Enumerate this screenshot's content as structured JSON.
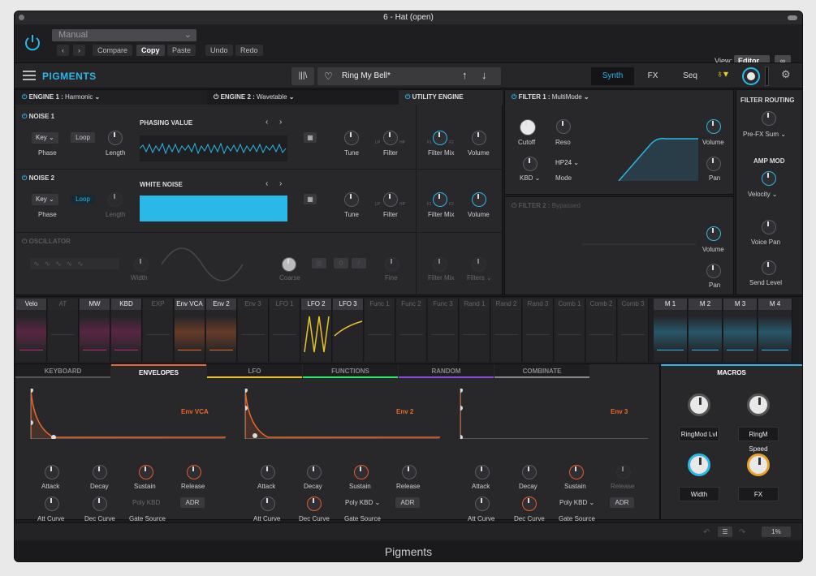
{
  "window": {
    "title": "6 - Hat (open)"
  },
  "plugin_toolbar": {
    "preset_select": "Manual",
    "compare": "Compare",
    "copy": "Copy",
    "paste": "Paste",
    "undo": "Undo",
    "redo": "Redo",
    "view_label": "View:",
    "view_value": "Editor"
  },
  "app": {
    "logo": "PIGMENTS",
    "preset_name": "Ring My Bell*",
    "tabs": {
      "synth": "Synth",
      "fx": "FX",
      "seq": "Seq"
    }
  },
  "engine1": {
    "title": "ENGINE 1 :",
    "type": "Harmonic",
    "noise1": {
      "title": "NOISE 1",
      "mode": "Key",
      "loop": "Loop",
      "phase": "Phase",
      "length": "Length",
      "sample_title": "PHASING VALUE",
      "tune": "Tune",
      "filter": "Filter",
      "lp": "LP",
      "hp": "HP"
    },
    "noise2": {
      "title": "NOISE 2",
      "mode": "Key",
      "loop": "Loop",
      "phase": "Phase",
      "length": "Length",
      "sample_title": "WHITE NOISE",
      "tune": "Tune",
      "filter": "Filter",
      "lp": "LP",
      "hp": "HP"
    },
    "oscillator": {
      "title": "OSCILLATOR",
      "width": "Width",
      "coarse": "Coarse",
      "fine": "Fine"
    }
  },
  "engine2": {
    "title": "ENGINE 2 :",
    "type": "Wavetable"
  },
  "utility": {
    "title": "UTILITY ENGINE",
    "filter_mix": "Filter Mix",
    "volume": "Volume",
    "f1": "F1",
    "f2": "F2",
    "filters": "Filters"
  },
  "filter1": {
    "title": "FILTER 1 :",
    "type": "MultiMode",
    "cutoff": "Cutoff",
    "reso": "Reso",
    "kbd": "KBD",
    "mode_value": "HP24",
    "mode": "Mode",
    "volume": "Volume",
    "pan": "Pan"
  },
  "filter2": {
    "title": "FILTER 2 :",
    "status": "Bypassed",
    "volume": "Volume",
    "pan": "Pan"
  },
  "routing": {
    "title": "FILTER ROUTING",
    "value": "Pre-FX Sum",
    "amp_mod": "AMP MOD",
    "amp_value": "Velocity",
    "voice_pan": "Voice Pan",
    "send_level": "Send Level"
  },
  "mod_sources": [
    "Velo",
    "AT",
    "MW",
    "KBD",
    "EXP",
    "Env VCA",
    "Env 2",
    "Env 3",
    "LFO 1",
    "LFO 2",
    "LFO 3",
    "Func 1",
    "Func 2",
    "Func 3",
    "Rand 1",
    "Rand 2",
    "Rand 3",
    "Comb 1",
    "Comb 2",
    "Comb 3",
    "M 1",
    "M 2",
    "M 3",
    "M 4"
  ],
  "bottom_tabs": [
    "KEYBOARD",
    "ENVELOPES",
    "LFO",
    "FUNCTIONS",
    "RANDOM",
    "COMBINATE"
  ],
  "envelopes": [
    {
      "name": "Env VCA",
      "attack": "Attack",
      "decay": "Decay",
      "sustain": "Sustain",
      "release": "Release",
      "att_curve": "Att Curve",
      "dec_curve": "Dec Curve",
      "gate_label": "Gate Source",
      "gate": "Poly KBD",
      "adr": "ADR"
    },
    {
      "name": "Env 2",
      "attack": "Attack",
      "decay": "Decay",
      "sustain": "Sustain",
      "release": "Release",
      "att_curve": "Att Curve",
      "dec_curve": "Dec Curve",
      "gate_label": "Gate Source",
      "gate": "Poly KBD",
      "adr": "ADR"
    },
    {
      "name": "Env 3",
      "attack": "Attack",
      "decay": "Decay",
      "sustain": "Sustain",
      "release": "Release",
      "att_curve": "Att Curve",
      "dec_curve": "Dec Curve",
      "gate_label": "Gate Source",
      "gate": "Poly KBD",
      "adr": "ADR"
    }
  ],
  "macros": {
    "title": "MACROS",
    "m1": "RingMod Lvl",
    "m2": "RingM Speed",
    "m3": "Width",
    "m4": "FX"
  },
  "status": {
    "cpu": "1%"
  },
  "footer": {
    "title": "Pigments"
  },
  "colors": {
    "accent": "#2ab8e8",
    "env": "#e8692a",
    "lfo": "#e8c22a"
  }
}
